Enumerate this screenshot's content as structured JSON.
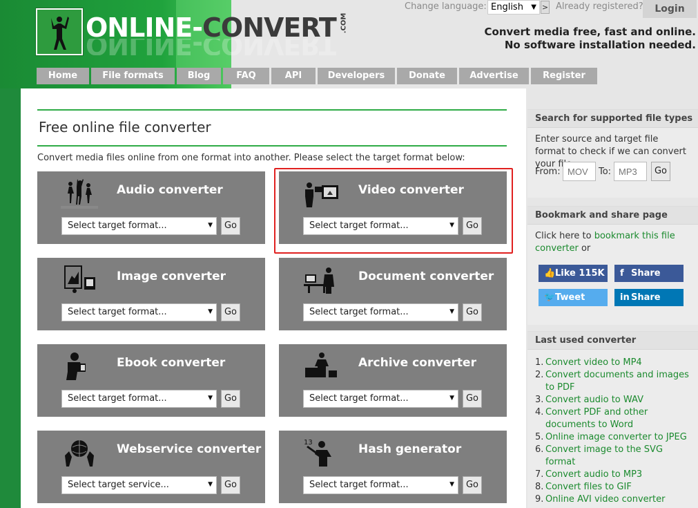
{
  "header": {
    "logo": {
      "part1": "ONLINE-",
      "part2": "CONVERT",
      "suffix": ".COM"
    },
    "change_language_label": "Change language:",
    "language_selected": "English",
    "language_go": ">",
    "already_registered": "Already registered?",
    "login": "Login",
    "tagline1": "Convert media free, fast and online.",
    "tagline2": "No software installation needed."
  },
  "nav": {
    "items": [
      "Home",
      "File formats",
      "Blog",
      "FAQ",
      "API",
      "Developers",
      "Donate",
      "Advertise",
      "Register"
    ]
  },
  "main": {
    "title": "Free online file converter",
    "intro": "Convert media files online from one format into another. Please select the target format below:",
    "cards": [
      {
        "title": "Audio converter",
        "select": "Select target format...",
        "go": "Go",
        "icon": "dancers-icon"
      },
      {
        "title": "Video converter",
        "select": "Select target format...",
        "go": "Go",
        "icon": "video-camera-icon"
      },
      {
        "title": "Image converter",
        "select": "Select target format...",
        "go": "Go",
        "icon": "photo-frame-icon"
      },
      {
        "title": "Document converter",
        "select": "Select target format...",
        "go": "Go",
        "icon": "office-worker-icon"
      },
      {
        "title": "Ebook converter",
        "select": "Select target format...",
        "go": "Go",
        "icon": "reader-icon"
      },
      {
        "title": "Archive converter",
        "select": "Select target format...",
        "go": "Go",
        "icon": "archive-box-icon"
      },
      {
        "title": "Webservice converter",
        "select": "Select target service...",
        "go": "Go",
        "icon": "globe-icon"
      },
      {
        "title": "Hash generator",
        "select": "Select target format...",
        "go": "Go",
        "icon": "hash-writer-icon"
      }
    ]
  },
  "sidebar": {
    "search": {
      "heading": "Search for supported file types",
      "text": "Enter source and target file format to check if we can convert your file:",
      "from_label": "From:",
      "from_placeholder": "MOV",
      "to_label": "To:",
      "to_placeholder": "MP3",
      "go": "Go"
    },
    "bookmark": {
      "heading": "Bookmark and share page",
      "text_before": "Click here to ",
      "link": "bookmark this file converter",
      "text_after": " or",
      "buttons": [
        {
          "label": "Like 115K",
          "icon": "thumbs-up-icon",
          "color": "#3b5998"
        },
        {
          "label": "Share",
          "icon": "facebook-icon",
          "color": "#3b5998"
        },
        {
          "label": "Tweet",
          "icon": "twitter-icon",
          "color": "#55acee"
        },
        {
          "label": "Share",
          "icon": "linkedin-icon",
          "color": "#0077b5"
        }
      ]
    },
    "last_used": {
      "heading": "Last used converter",
      "items": [
        "Convert video to MP4",
        "Convert documents and images to PDF",
        "Convert audio to WAV",
        "Convert PDF and other documents to Word",
        "Online image converter to JPEG",
        "Convert image to the SVG format",
        "Convert audio to MP3",
        "Convert files to GIF",
        "Online AVI video converter"
      ]
    }
  },
  "colors": {
    "brand_green": "#1f8a3b",
    "link_green": "#1b8a2e",
    "card_gray": "#7f7f7f",
    "nav_gray": "#a9a9a9",
    "highlight_red": "#e0201f"
  }
}
